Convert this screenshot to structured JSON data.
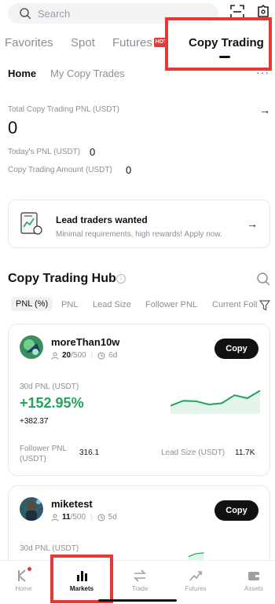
{
  "search": {
    "placeholder": "Search"
  },
  "icons": {
    "scan": "scan-icon",
    "settings": "settings-icon"
  },
  "top_tabs": [
    {
      "label": "Favorites"
    },
    {
      "label": "Spot"
    },
    {
      "label": "Futures"
    },
    {
      "label": "Copy Trading"
    }
  ],
  "futures_badge": "HOT",
  "sub_tabs": [
    {
      "label": "Home"
    },
    {
      "label": "My Copy Trades"
    }
  ],
  "more_label": "···",
  "summary": {
    "total_label": "Total Copy Trading PNL (USDT)",
    "total_value": "0",
    "today_label": "Today's PNL (USDT)",
    "today_value": "0",
    "amount_label": "Copy Trading Amount (USDT)",
    "amount_value": "0"
  },
  "banner": {
    "title": "Lead traders wanted",
    "subtitle": "Minimal requirements, high rewards! Apply now."
  },
  "hub": {
    "title": "Copy Trading Hub",
    "info_glyph": "i",
    "filters": [
      "PNL (%)",
      "PNL",
      "Lead Size",
      "Follower PNL",
      "Current Foll"
    ]
  },
  "traders": [
    {
      "name": "moreThan10w",
      "followers": "20",
      "max_followers": "/500",
      "days": "6d",
      "copy_label": "Copy",
      "pnl_label": "30d PNL (USDT)",
      "pnl_pct": "+152.95%",
      "pnl_abs": "+382.37",
      "follower_pnl_label": "Follower PNL (USDT)",
      "follower_pnl_value": "316.1",
      "lead_size_label": "Lead Size (USDT)",
      "lead_size_value": "11.7K",
      "sparkline": [
        0.2,
        0.4,
        0.38,
        0.25,
        0.3,
        0.62,
        0.5,
        0.8
      ]
    },
    {
      "name": "miketest",
      "followers": "11",
      "max_followers": "/500",
      "days": "5d",
      "copy_label": "Copy",
      "pnl_label": "30d PNL (USDT)",
      "sparkline": [
        0.1,
        0.3,
        0.35
      ]
    }
  ],
  "bottom_nav": [
    {
      "label": "Home",
      "icon": "home-icon"
    },
    {
      "label": "Markets",
      "icon": "markets-icon"
    },
    {
      "label": "Trade",
      "icon": "trade-icon"
    },
    {
      "label": "Futures",
      "icon": "futures-icon"
    },
    {
      "label": "Assets",
      "icon": "assets-icon"
    }
  ],
  "colors": {
    "positive": "#1fa45c",
    "accent_red": "#e53935"
  }
}
